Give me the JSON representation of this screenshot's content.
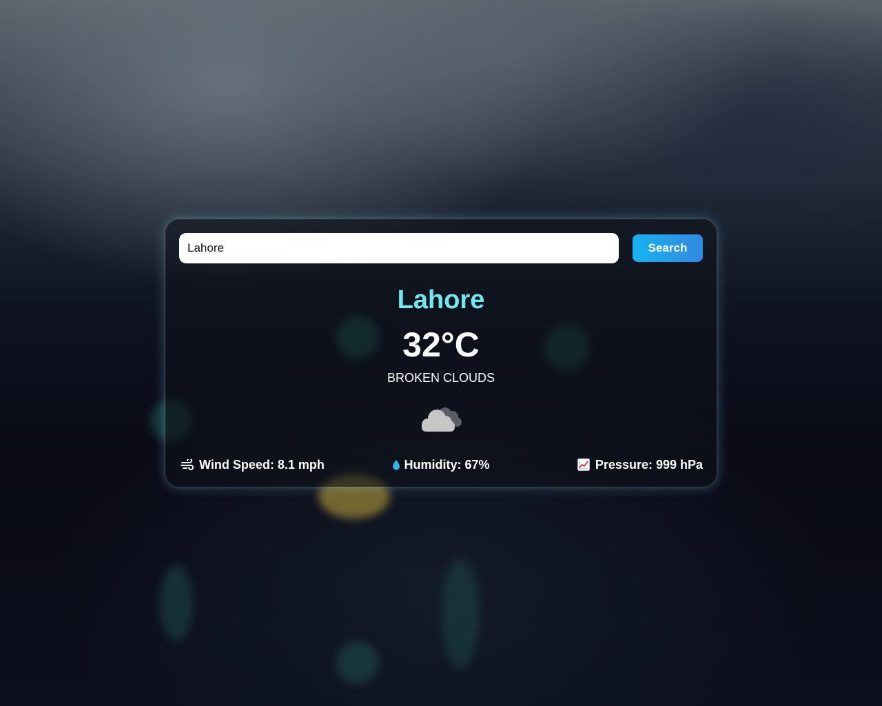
{
  "search": {
    "value": "Lahore",
    "button_label": "Search"
  },
  "weather": {
    "city": "Lahore",
    "temperature": "32°C",
    "description": "BROKEN CLOUDS",
    "icon": "broken-clouds-icon"
  },
  "stats": {
    "wind": {
      "label": "Wind Speed: 8.1 mph",
      "icon": "wind-icon"
    },
    "humidity": {
      "label": "Humidity: 67%",
      "icon": "water-drop-icon"
    },
    "pressure": {
      "label": "Pressure: 999 hPa",
      "icon": "chart-increasing-icon"
    }
  },
  "colors": {
    "city_text": "#72e8ee",
    "button_gradient_start": "#16b3ee",
    "button_gradient_end": "#3388e0"
  }
}
